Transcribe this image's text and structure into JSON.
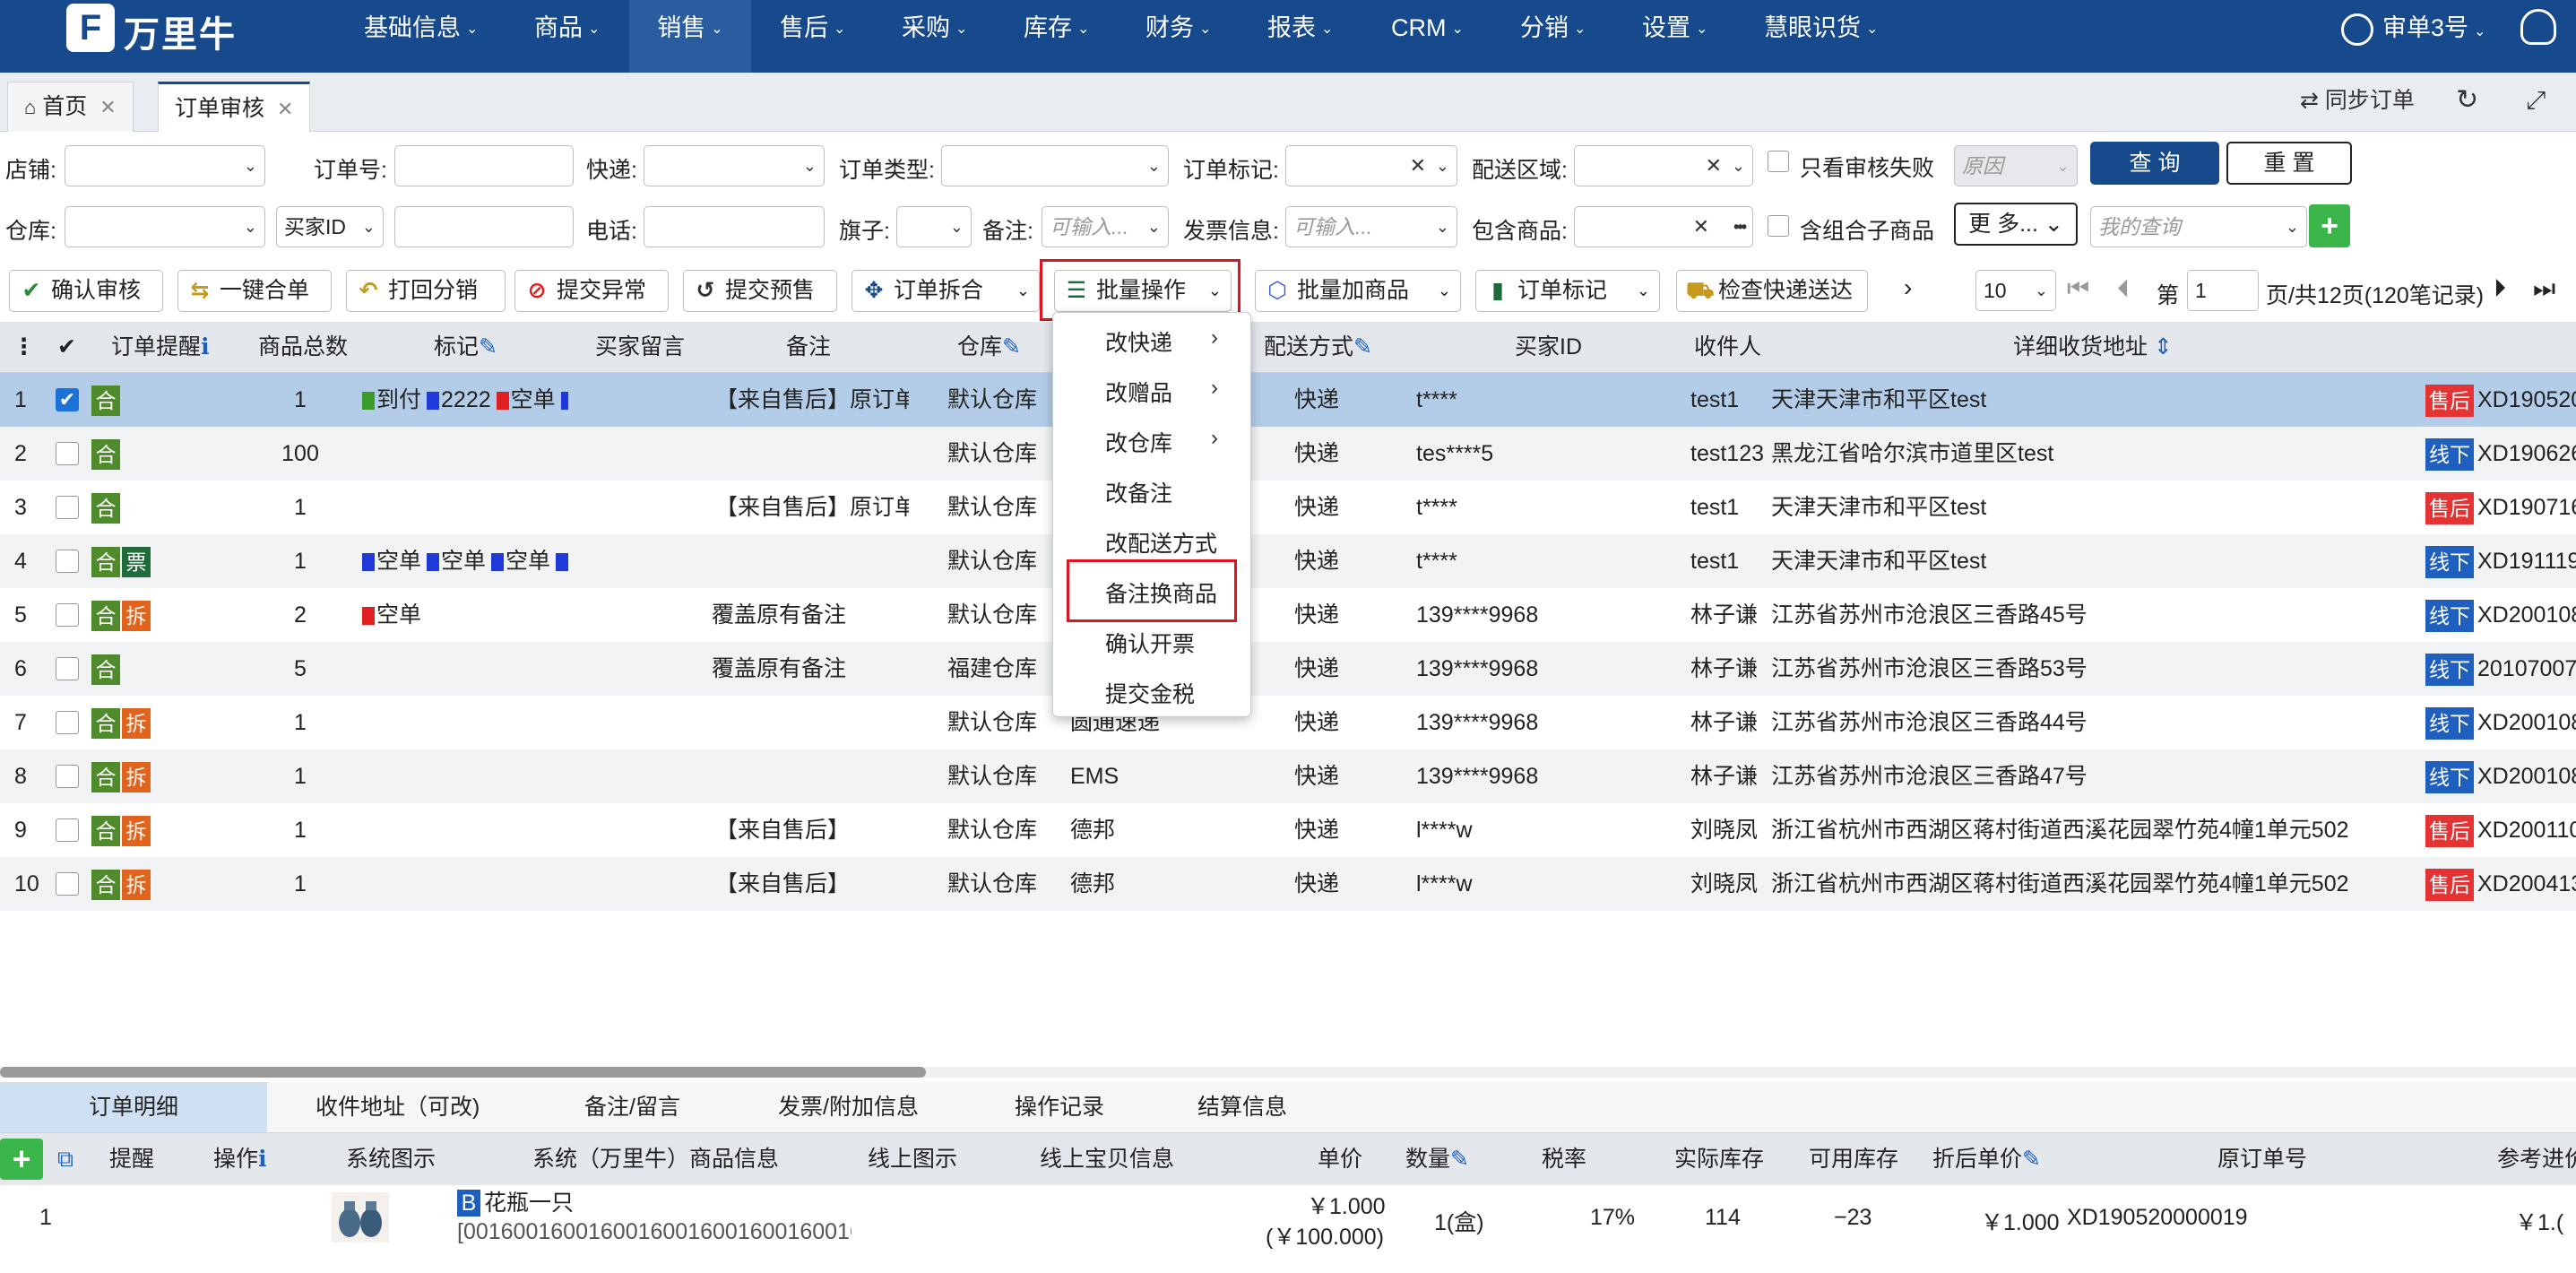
{
  "app": {
    "logo_mark": "F",
    "name": "万里牛"
  },
  "nav": {
    "items": [
      "基础信息",
      "商品",
      "销售",
      "售后",
      "采购",
      "库存",
      "财务",
      "报表",
      "CRM",
      "分销",
      "设置",
      "慧眼识货"
    ],
    "active": "销售",
    "user": "审单3号"
  },
  "tabs": {
    "home": "首页",
    "current": "订单审核",
    "sync": "同步订单"
  },
  "filters": {
    "shop": "店铺:",
    "order_no": "订单号:",
    "express": "快递:",
    "order_type": "订单类型:",
    "order_mark": "订单标记:",
    "area": "配送区域:",
    "only_failed": "只看审核失败",
    "reason_placeholder": "原因",
    "query": "查 询",
    "reset": "重 置",
    "warehouse": "仓库:",
    "buyer_id_select": "买家ID",
    "phone": "电话:",
    "flag": "旗子:",
    "remark": "备注:",
    "remark_placeholder": "可输入...",
    "invoice": "发票信息:",
    "invoice_placeholder": "可输入...",
    "contains_goods": "包含商品:",
    "include_combo": "含组合子商品",
    "more": "更 多...",
    "my_query_placeholder": "我的查询"
  },
  "toolbar": {
    "buttons": [
      "确认审核",
      "一键合单",
      "打回分销",
      "提交异常",
      "提交预售",
      "订单拆合",
      "批量操作",
      "批量加商品",
      "订单标记",
      "检查快递送达"
    ],
    "page_size": "10",
    "page_label": "第",
    "page_value": "1",
    "page_info": "页/共12页(120笔记录)"
  },
  "table": {
    "headers": [
      "订单提醒",
      "商品总数",
      "标记",
      "买家留言",
      "备注",
      "仓库",
      "配送方式",
      "买家ID",
      "收件人",
      "详细收货地址"
    ],
    "rows": [
      {
        "no": "1",
        "selected": true,
        "tags": [
          "合"
        ],
        "qty": "1",
        "marks": [
          {
            "c": "#3a9a2a",
            "t": "到付"
          },
          {
            "c": "#1f3ad8",
            "t": "2222"
          },
          {
            "c": "#e02020",
            "t": "空单"
          },
          {
            "c": "#1f3ad8",
            "t": ""
          }
        ],
        "note": "【来自售后】原订单:",
        "wh": "默认仓库",
        "exp": "",
        "ship": "快递",
        "buyer": "t****",
        "recv": "test1",
        "addr": "天津天津市和平区test",
        "src": "售后",
        "code": "XD190520"
      },
      {
        "no": "2",
        "selected": false,
        "tags": [
          "合"
        ],
        "qty": "100",
        "marks": [],
        "note": "",
        "wh": "默认仓库",
        "exp": "",
        "ship": "快递",
        "buyer": "tes****5",
        "recv": "test123",
        "addr": "黑龙江省哈尔滨市道里区test",
        "src": "线下",
        "code": "XD190626"
      },
      {
        "no": "3",
        "selected": false,
        "tags": [
          "合"
        ],
        "qty": "1",
        "marks": [],
        "note": "【来自售后】原订单:",
        "wh": "默认仓库",
        "exp": "",
        "ship": "快递",
        "buyer": "t****",
        "recv": "test1",
        "addr": "天津天津市和平区test",
        "src": "售后",
        "code": "XD190716"
      },
      {
        "no": "4",
        "selected": false,
        "tags": [
          "合",
          "票"
        ],
        "qty": "1",
        "marks": [
          {
            "c": "#1f3ad8",
            "t": "空单"
          },
          {
            "c": "#1f3ad8",
            "t": "空单"
          },
          {
            "c": "#1f3ad8",
            "t": "空单"
          },
          {
            "c": "#1f3ad8",
            "t": ""
          }
        ],
        "note": "",
        "wh": "默认仓库",
        "exp": "",
        "ship": "快递",
        "buyer": "t****",
        "recv": "test1",
        "addr": "天津天津市和平区test",
        "src": "线下",
        "code": "XD191119"
      },
      {
        "no": "5",
        "selected": false,
        "tags": [
          "合",
          "拆"
        ],
        "qty": "2",
        "marks": [
          {
            "c": "#e02020",
            "t": "空单"
          }
        ],
        "msg": "覆盖原有备注",
        "note": "",
        "wh": "默认仓库",
        "exp": "",
        "ship": "快递",
        "buyer": "139****9968",
        "recv": "林子谦",
        "addr": "江苏省苏州市沧浪区三香路45号",
        "src": "线下",
        "code": "XD200108"
      },
      {
        "no": "6",
        "selected": false,
        "tags": [
          "合"
        ],
        "qty": "5",
        "marks": [],
        "msg": "覆盖原有备注",
        "note": "",
        "wh": "福建仓库",
        "exp": "",
        "ship": "快递",
        "buyer": "139****9968",
        "recv": "林子谦",
        "addr": "江苏省苏州市沧浪区三香路53号",
        "src": "线下",
        "code": "20107007"
      },
      {
        "no": "7",
        "selected": false,
        "tags": [
          "合",
          "拆"
        ],
        "qty": "1",
        "marks": [],
        "note": "",
        "wh": "默认仓库",
        "exp": "圆通速递",
        "ship": "快递",
        "buyer": "139****9968",
        "recv": "林子谦",
        "addr": "江苏省苏州市沧浪区三香路44号",
        "src": "线下",
        "code": "XD200108"
      },
      {
        "no": "8",
        "selected": false,
        "tags": [
          "合",
          "拆"
        ],
        "qty": "1",
        "marks": [],
        "note": "",
        "wh": "默认仓库",
        "exp": "EMS",
        "ship": "快递",
        "buyer": "139****9968",
        "recv": "林子谦",
        "addr": "江苏省苏州市沧浪区三香路47号",
        "src": "线下",
        "code": "XD200108"
      },
      {
        "no": "9",
        "selected": false,
        "tags": [
          "合",
          "拆"
        ],
        "qty": "1",
        "marks": [],
        "note": "【来自售后】",
        "wh": "默认仓库",
        "exp": "德邦",
        "ship": "快递",
        "buyer": "l****w",
        "recv": "刘晓凤",
        "addr": "浙江省杭州市西湖区蒋村街道西溪花园翠竹苑4幢1单元502",
        "src": "售后",
        "code": "XD200110"
      },
      {
        "no": "10",
        "selected": false,
        "tags": [
          "合",
          "拆"
        ],
        "qty": "1",
        "marks": [],
        "note": "【来自售后】",
        "wh": "默认仓库",
        "exp": "德邦",
        "ship": "快递",
        "buyer": "l****w",
        "recv": "刘晓凤",
        "addr": "浙江省杭州市西湖区蒋村街道西溪花园翠竹苑4幢1单元502",
        "src": "售后",
        "code": "XD200413"
      }
    ]
  },
  "batch_menu": {
    "items": [
      "改快递",
      "改赠品",
      "改仓库",
      "改备注",
      "改配送方式",
      "备注换商品",
      "确认开票",
      "提交金税"
    ],
    "highlighted": "备注换商品"
  },
  "bottom": {
    "tabs": [
      "订单明细",
      "收件地址（可改)",
      "备注/留言",
      "发票/附加信息",
      "操作记录",
      "结算信息"
    ],
    "headers": [
      "提醒",
      "操作",
      "系统图示",
      "系统（万里牛）商品信息",
      "线上图示",
      "线上宝贝信息",
      "单价",
      "数量",
      "税率",
      "实际库存",
      "可用库存",
      "折后单价",
      "原订单号",
      "参考进价"
    ],
    "row": {
      "no": "1",
      "badge": "B",
      "name": "花瓶一只",
      "code": "[0016001600160016001600160016001600160016",
      "price": "￥1.000",
      "price2": "(￥100.000)",
      "qty": "1(盒)",
      "tax": "17%",
      "stock": "114",
      "avail": "−23",
      "disc": "￥1.000",
      "orig": "XD190520000019",
      "ref": "￥1.("
    }
  },
  "colors": {
    "nav_bg": "#174a8c",
    "highlight_row": "#b3cde8",
    "menu_outline": "#e0141e"
  }
}
